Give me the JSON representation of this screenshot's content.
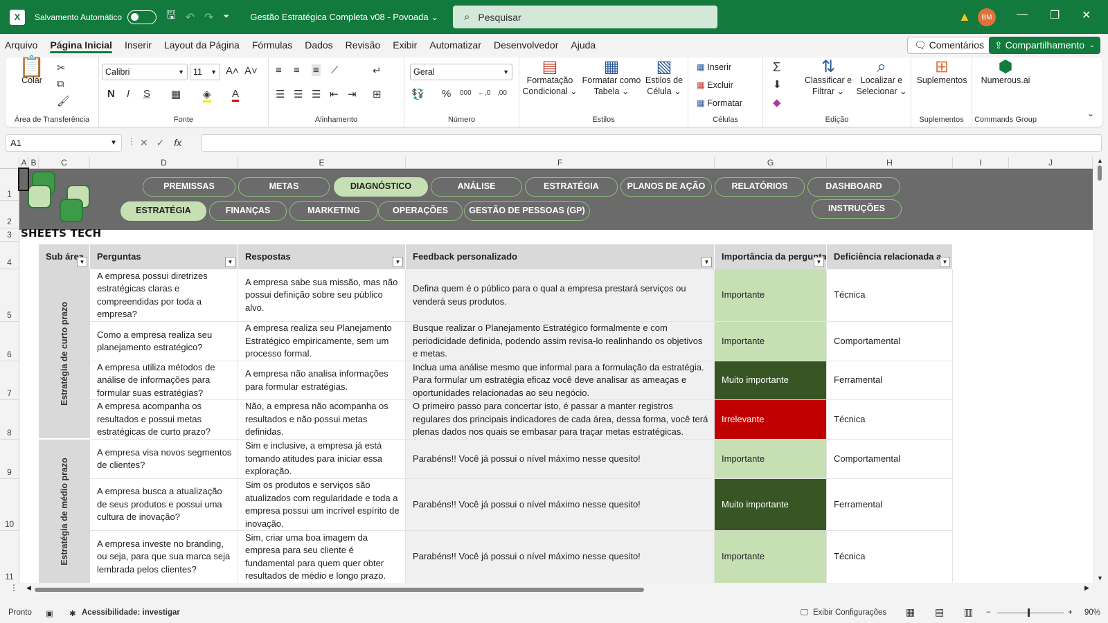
{
  "titlebar": {
    "autosave_label": "Salvamento Automático",
    "doc_title": "Gestão Estratégica Completa v08 - Povoada ⌄",
    "search_placeholder": "Pesquisar",
    "avatar_initials": "BM"
  },
  "menu": {
    "tabs": [
      "Arquivo",
      "Página Inicial",
      "Inserir",
      "Layout da Página",
      "Fórmulas",
      "Dados",
      "Revisão",
      "Exibir",
      "Automatizar",
      "Desenvolvedor",
      "Ajuda"
    ],
    "comments": "Comentários",
    "share": "Compartilhamento"
  },
  "ribbon": {
    "clipboard": {
      "paste": "Colar",
      "label": "Área de Transferência"
    },
    "font": {
      "name": "Calibri",
      "size": "11",
      "label": "Fonte"
    },
    "alignment": {
      "label": "Alinhamento"
    },
    "number": {
      "format": "Geral",
      "label": "Número"
    },
    "styles": {
      "conditional": "Formatação Condicional ⌄",
      "table": "Formatar como Tabela ⌄",
      "cell": "Estilos de Célula ⌄",
      "label": "Estilos"
    },
    "cells": {
      "insert": "Inserir",
      "delete": "Excluir",
      "format": "Formatar",
      "label": "Células"
    },
    "editing": {
      "sort": "Classificar e Filtrar ⌄",
      "find": "Localizar e Selecionar ⌄",
      "label": "Edição"
    },
    "addins": {
      "btn": "Suplementos",
      "label": "Suplementos"
    },
    "commands": {
      "btn": "Numerous.ai",
      "label": "Commands Group"
    }
  },
  "formulabar": {
    "cell_ref": "A1",
    "fx": "fx",
    "formula": ""
  },
  "columns": [
    "A",
    "B",
    "C",
    "D",
    "E",
    "F",
    "G",
    "H",
    "I",
    "J"
  ],
  "rows": [
    "1",
    "2",
    "3",
    "4",
    "5",
    "6",
    "7",
    "8",
    "9",
    "10",
    "11"
  ],
  "nav": {
    "row1": [
      "PREMISSAS",
      "METAS",
      "DIAGNÓSTICO",
      "ANÁLISE",
      "ESTRATÉGIA",
      "PLANOS DE AÇÃO",
      "RELATÓRIOS",
      "DASHBOARD"
    ],
    "row2": [
      "ESTRATÉGIA",
      "FINANÇAS",
      "MARKETING",
      "OPERAÇÕES",
      "GESTÃO DE PESSOAS (GP)"
    ],
    "instructions": "INSTRUÇÕES"
  },
  "brand": "SHEETS TECH",
  "table": {
    "headers": [
      "Sub área",
      "Perguntas",
      "Respostas",
      "Feedback personalizado",
      "Importância da pergunta",
      "Deficiência relacionada a"
    ],
    "subareas": [
      "Estratégia de curto prazo",
      "Estratégia de médio prazo"
    ],
    "rows": [
      {
        "q": "A empresa possui diretrizes estratégicas claras e compreendidas por toda a empresa?",
        "a": "A empresa sabe  sua missão, mas não possui definição sobre seu público alvo.",
        "f": "Defina quem é o público para o qual a empresa prestará serviços ou venderá seus produtos.",
        "imp": "Importante",
        "def": "Técnica"
      },
      {
        "q": "Como a empresa realiza seu planejamento estratégico?",
        "a": "A empresa realiza seu Planejamento Estratégico empiricamente, sem um processo formal.",
        "f": "Busque realizar o Planejamento Estratégico formalmente e com periodicidade definida, podendo assim revisa-lo realinhando os objetivos e metas.",
        "imp": "Importante",
        "def": "Comportamental"
      },
      {
        "q": "A empresa utiliza métodos de análise de informações para formular suas estratégias?",
        "a": "A empresa não analisa informações para formular estratégias.",
        "f": "Inclua uma análise mesmo que informal para a formulação da estratégia. Para formular um estratégia eficaz você deve analisar as ameaças e oportunidades relacionadas ao seu negócio.",
        "imp": "Muito importante",
        "def": "Ferramental"
      },
      {
        "q": "A empresa acompanha os resultados e possui metas estratégicas de curto prazo?",
        "a": "Não, a empresa não acompanha os resultados e não possui metas definidas.",
        "f": "O primeiro passo para concertar isto, é passar a manter registros regulares dos principais indicadores de cada área, dessa forma, você terá plenas dados nos quais se embasar para traçar metas estratégicas.",
        "imp": "Irrelevante",
        "def": "Técnica"
      },
      {
        "q": "A empresa visa novos segmentos de clientes?",
        "a": "Sim e inclusive, a empresa já está tomando atitudes para iniciar essa exploração.",
        "f": "Parabéns!! Você já possui o nível máximo nesse quesito!",
        "imp": "Importante",
        "def": "Comportamental"
      },
      {
        "q": "A empresa busca a atualização de seus produtos e possui uma cultura de inovação?",
        "a": "Sim os produtos e serviços são atualizados com regularidade e toda a empresa possui um incrível espírito de inovação.",
        "f": "Parabéns!! Você já possui o nível máximo nesse quesito!",
        "imp": "Muito importante",
        "def": "Ferramental"
      },
      {
        "q": "A empresa investe no branding, ou seja, para que sua marca seja lembrada pelos clientes?",
        "a": "Sim, criar uma boa imagem da empresa para seu cliente é fundamental para quem quer obter resultados de médio e longo prazo.",
        "f": "Parabéns!! Você já possui o nível máximo nesse quesito!",
        "imp": "Importante",
        "def": "Técnica"
      }
    ]
  },
  "importance_colors": {
    "Importante": "#c6e0b4",
    "Muito importante": "#375623",
    "Irrelevante": "#c00000"
  },
  "status": {
    "ready": "Pronto",
    "accessibility": "Acessibilidade: investigar",
    "display_settings": "Exibir Configurações",
    "zoom": "90%"
  }
}
